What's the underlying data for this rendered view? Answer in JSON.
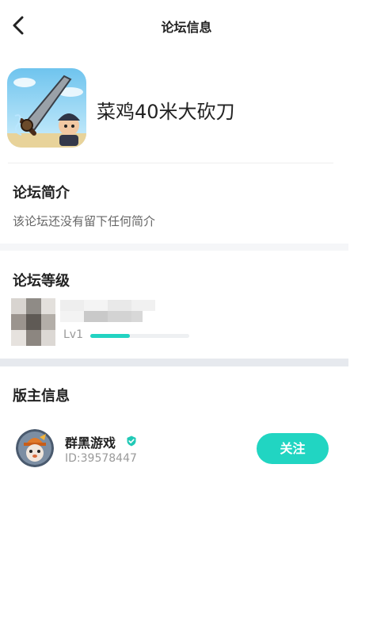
{
  "header": {
    "title": "论坛信息",
    "back_icon": "chevron-left-icon"
  },
  "game": {
    "name": "菜鸡40米大砍刀",
    "icon": "game-cover-image"
  },
  "intro": {
    "title": "论坛简介",
    "text": "该论坛还没有留下任何简介"
  },
  "level": {
    "title": "论坛等级",
    "label": "Lv1",
    "progress": 0.4,
    "accent": "#22d3c2"
  },
  "moderator": {
    "title": "版主信息",
    "name": "群黑游戏",
    "id": "ID:39578447",
    "verified_icon": "verified-badge-icon",
    "follow_label": "关注",
    "accent": "#21d5c2"
  }
}
